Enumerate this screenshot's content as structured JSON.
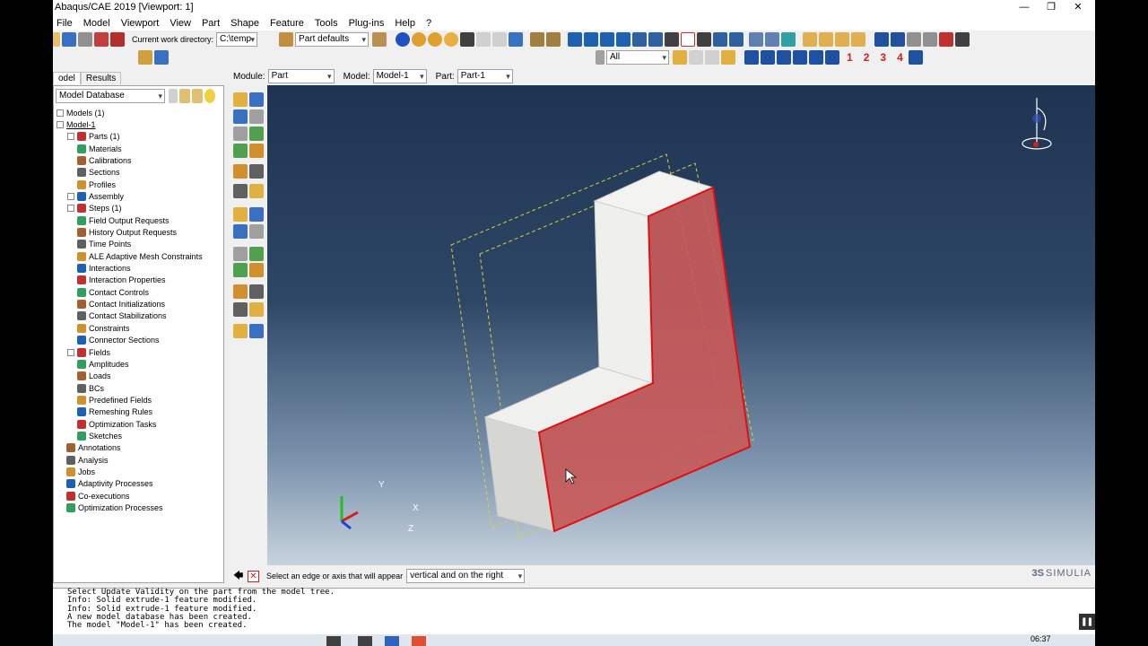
{
  "window": {
    "title": "Abaqus/CAE 2019 [Viewport: 1]",
    "controls": [
      "—",
      "❐",
      "✕"
    ]
  },
  "menu": [
    "File",
    "Model",
    "Viewport",
    "View",
    "Part",
    "Shape",
    "Feature",
    "Tools",
    "Plug-ins",
    "Help",
    "?"
  ],
  "toolbar": {
    "workdir_label": "Current work directory:",
    "workdir_value": "C:\\temp",
    "part_defaults": "Part defaults",
    "selection_filter": "All",
    "view_numbers": [
      "1",
      "2",
      "3",
      "4"
    ]
  },
  "context": {
    "module_label": "Module:",
    "module_value": "Part",
    "model_label": "Model:",
    "model_value": "Model-1",
    "part_label": "Part:",
    "part_value": "Part-1"
  },
  "tabs": [
    "odel",
    "Results"
  ],
  "tree": {
    "header": "Model Database",
    "items": [
      {
        "label": "Models (1)",
        "level": 0,
        "exp": "⊟"
      },
      {
        "label": "Model-1",
        "level": 0,
        "exp": "⊟"
      },
      {
        "label": "Parts (1)",
        "level": 1,
        "exp": "+"
      },
      {
        "label": "Materials",
        "level": 1,
        "exp": ""
      },
      {
        "label": "Calibrations",
        "level": 1,
        "exp": ""
      },
      {
        "label": "Sections",
        "level": 1,
        "exp": ""
      },
      {
        "label": "Profiles",
        "level": 1,
        "exp": ""
      },
      {
        "label": "Assembly",
        "level": 1,
        "exp": "+"
      },
      {
        "label": "Steps (1)",
        "level": 1,
        "exp": "+"
      },
      {
        "label": "Field Output Requests",
        "level": 1,
        "exp": ""
      },
      {
        "label": "History Output Requests",
        "level": 1,
        "exp": ""
      },
      {
        "label": "Time Points",
        "level": 1,
        "exp": ""
      },
      {
        "label": "ALE Adaptive Mesh Constraints",
        "level": 1,
        "exp": ""
      },
      {
        "label": "Interactions",
        "level": 1,
        "exp": ""
      },
      {
        "label": "Interaction Properties",
        "level": 1,
        "exp": ""
      },
      {
        "label": "Contact Controls",
        "level": 1,
        "exp": ""
      },
      {
        "label": "Contact Initializations",
        "level": 1,
        "exp": ""
      },
      {
        "label": "Contact Stabilizations",
        "level": 1,
        "exp": ""
      },
      {
        "label": "Constraints",
        "level": 1,
        "exp": ""
      },
      {
        "label": "Connector Sections",
        "level": 1,
        "exp": ""
      },
      {
        "label": "Fields",
        "level": 1,
        "exp": "+"
      },
      {
        "label": "Amplitudes",
        "level": 1,
        "exp": ""
      },
      {
        "label": "Loads",
        "level": 1,
        "exp": ""
      },
      {
        "label": "BCs",
        "level": 1,
        "exp": ""
      },
      {
        "label": "Predefined Fields",
        "level": 1,
        "exp": ""
      },
      {
        "label": "Remeshing Rules",
        "level": 1,
        "exp": ""
      },
      {
        "label": "Optimization Tasks",
        "level": 1,
        "exp": ""
      },
      {
        "label": "Sketches",
        "level": 1,
        "exp": ""
      },
      {
        "label": "Annotations",
        "level": 0,
        "exp": ""
      },
      {
        "label": "Analysis",
        "level": 0,
        "exp": ""
      },
      {
        "label": "Jobs",
        "level": 0,
        "exp": ""
      },
      {
        "label": "Adaptivity Processes",
        "level": 0,
        "exp": ""
      },
      {
        "label": "Co-executions",
        "level": 0,
        "exp": ""
      },
      {
        "label": "Optimization Processes",
        "level": 0,
        "exp": ""
      }
    ]
  },
  "viewport": {
    "axis_x": "X",
    "axis_y": "Y",
    "axis_z": "Z",
    "brand": "SIMULIA",
    "brand_mark": "3S",
    "colors": {
      "selected_face": "#c85a5a",
      "selected_edge": "#e01010",
      "face_light": "#f0f0ee",
      "face_mid": "#d6d6d2",
      "datum_plane": "#d4d43a"
    }
  },
  "prompt": {
    "text": "Select an edge or axis that will appear",
    "select_value": "vertical and on the right"
  },
  "console": {
    "lines": [
      "Select Update Validity on the part from the model tree.",
      "Info: Solid extrude-1 feature modified.",
      "Info: Solid extrude-1 feature modified.",
      "A new model database has been created.",
      "The model \"Model-1\" has been created."
    ]
  },
  "taskbar": {
    "clock": "06:37"
  }
}
